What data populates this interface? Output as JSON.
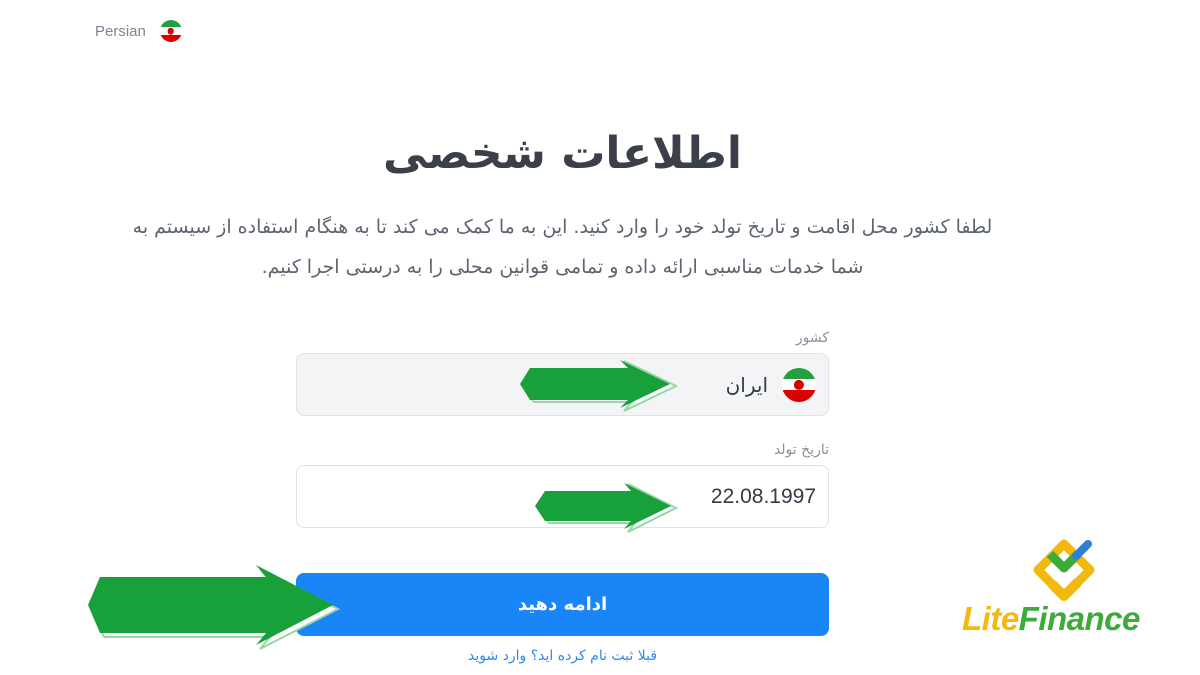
{
  "language_selector": {
    "label": "Persian",
    "flag_icon": "iran-flag-icon"
  },
  "title": "اطلاعات شخصی",
  "description_line1": "لطفا کشور محل اقامت و تاریخ تولد خود را وارد کنید. این به ما کمک می کند تا به هنگام استفاده از سیستم به",
  "description_line2": "شما خدمات مناسبی ارائه داده و تمامی قوانین محلی را به درستی اجرا کنیم.",
  "country_field": {
    "label": "کشور",
    "value": "ایران",
    "flag_icon": "iran-flag-icon"
  },
  "birthdate_field": {
    "label": "تاریخ تولد",
    "value": "22.08.1997"
  },
  "submit_button": {
    "label": "ادامه دهید"
  },
  "login_link": {
    "label": "قبلا ثبت نام کرده اید؟ وارد شوید"
  },
  "brand": {
    "name_part1": "Lite",
    "name_part2": "Finance"
  },
  "colors": {
    "primary_button": "#1a85f7",
    "link": "#2d89f2",
    "arrow_green": "#18a03b",
    "brand_yellow": "#f2b90f",
    "brand_green": "#3dab3a",
    "brand_blue": "#2f7fd9"
  }
}
